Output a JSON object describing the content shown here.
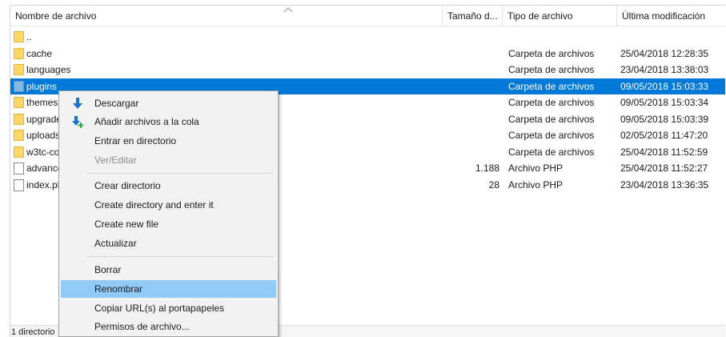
{
  "columns": {
    "name": "Nombre de archivo",
    "size": "Tamaño d...",
    "type": "Tipo de archivo",
    "modified": "Última modificación"
  },
  "rows": [
    {
      "name": "..",
      "size": "",
      "type": "",
      "modified": "",
      "kind": "folder"
    },
    {
      "name": "cache",
      "size": "",
      "type": "Carpeta de archivos",
      "modified": "25/04/2018 12:28:35",
      "kind": "folder"
    },
    {
      "name": "languages",
      "size": "",
      "type": "Carpeta de archivos",
      "modified": "23/04/2018 13:38:03",
      "kind": "folder"
    },
    {
      "name": "plugins",
      "size": "",
      "type": "Carpeta de archivos",
      "modified": "09/05/2018 15:03:33",
      "kind": "folder",
      "selected": true
    },
    {
      "name": "themes",
      "size": "",
      "type": "Carpeta de archivos",
      "modified": "09/05/2018 15:03:34",
      "kind": "folder"
    },
    {
      "name": "upgrade",
      "size": "",
      "type": "Carpeta de archivos",
      "modified": "09/05/2018 15:03:39",
      "kind": "folder"
    },
    {
      "name": "uploads",
      "size": "",
      "type": "Carpeta de archivos",
      "modified": "02/05/2018 11:47:20",
      "kind": "folder"
    },
    {
      "name": "w3tc-co",
      "size": "",
      "type": "Carpeta de archivos",
      "modified": "25/04/2018 11:52:59",
      "kind": "folder"
    },
    {
      "name": "advance",
      "size": "1.188",
      "type": "Archivo PHP",
      "modified": "25/04/2018 11:52:27",
      "kind": "file"
    },
    {
      "name": "index.ph",
      "size": "28",
      "type": "Archivo PHP",
      "modified": "23/04/2018 13:36:35",
      "kind": "file"
    }
  ],
  "status": "1 directorio",
  "context_menu": {
    "items": [
      {
        "label": "Descargar",
        "icon": "download-arrow-icon"
      },
      {
        "label": "Añadir archivos a la cola",
        "icon": "add-to-queue-icon"
      },
      {
        "label": "Entrar en directorio"
      },
      {
        "label": "Ver/Editar",
        "disabled": true
      },
      {
        "label": "Crear directorio"
      },
      {
        "label": "Create directory and enter it"
      },
      {
        "label": "Create new file"
      },
      {
        "label": "Actualizar"
      },
      {
        "label": "Borrar"
      },
      {
        "label": "Renombrar",
        "highlighted": true
      },
      {
        "label": "Copiar URL(s) al portapapeles"
      },
      {
        "label": "Permisos de archivo..."
      }
    ]
  },
  "colors": {
    "selection": "#0078d7",
    "menu_highlight": "#91c9f7",
    "folder": "#ffd766"
  }
}
